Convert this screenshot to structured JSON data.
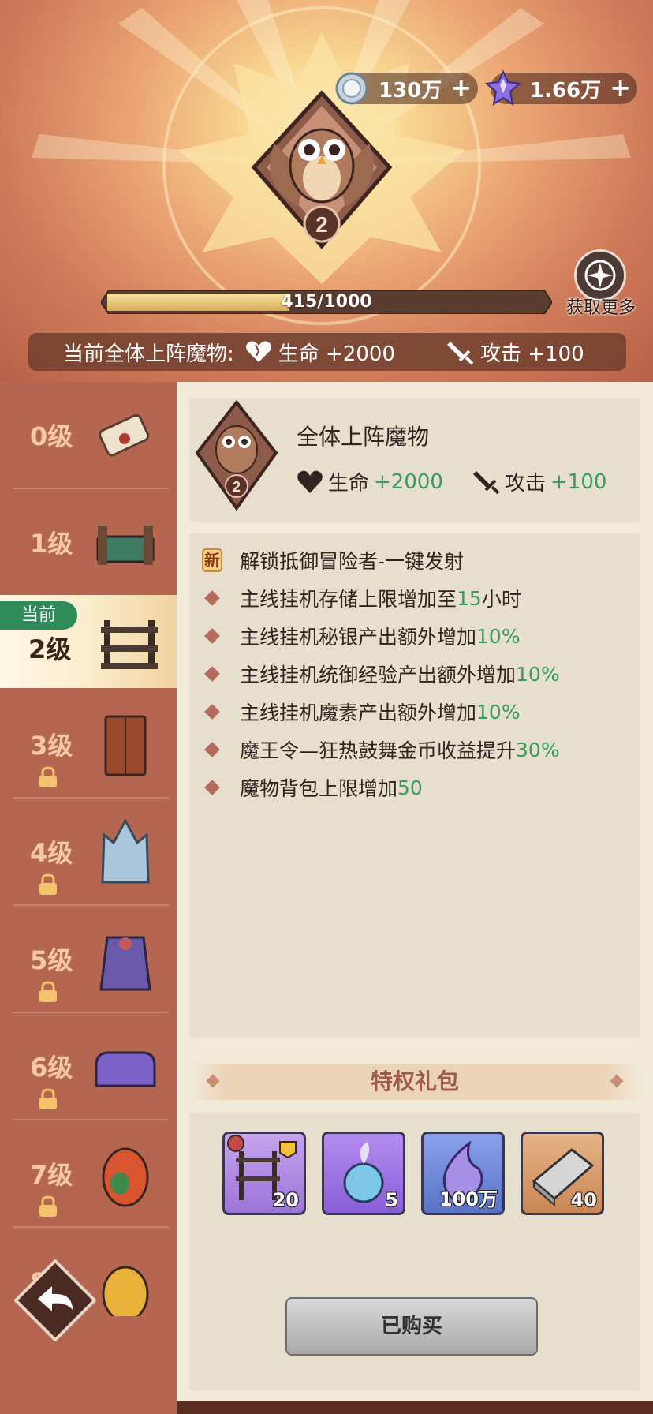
{
  "currencies": [
    {
      "icon": "silver-coin-icon",
      "amount": "130万",
      "plus": "+"
    },
    {
      "icon": "purple-crystal-icon",
      "amount": "1.66万",
      "plus": "+"
    }
  ],
  "header": {
    "badge_level": "2",
    "exp_text": "415/1000",
    "exp_progress": 0.415,
    "get_more_label": "获取更多",
    "bonus_prefix": "当前全体上阵魔物:",
    "bonus_hp": "生命 +2000",
    "bonus_atk": "攻击 +100"
  },
  "levels": [
    {
      "label": "0级",
      "locked": false,
      "current": false,
      "art": "scroll-icon"
    },
    {
      "label": "1级",
      "locked": false,
      "current": false,
      "art": "bed-icon"
    },
    {
      "label": "2级",
      "locked": false,
      "current": true,
      "art": "shelf-icon"
    },
    {
      "label": "3级",
      "locked": true,
      "current": false,
      "art": "wardrobe-icon"
    },
    {
      "label": "4级",
      "locked": true,
      "current": false,
      "art": "crystal-mirror-icon"
    },
    {
      "label": "5级",
      "locked": true,
      "current": false,
      "art": "purple-cabinet-icon"
    },
    {
      "label": "6级",
      "locked": true,
      "current": false,
      "art": "sofa-icon"
    },
    {
      "label": "7级",
      "locked": true,
      "current": false,
      "art": "egg-icon"
    },
    {
      "label": "8级",
      "locked": true,
      "current": false,
      "art": "golden-egg-icon"
    }
  ],
  "current_tag": "当前",
  "summary": {
    "title": "全体上阵魔物",
    "badge_level": "2",
    "hp_label": "生命",
    "hp_value": "+2000",
    "atk_label": "攻击",
    "atk_value": "+100"
  },
  "perks": [
    {
      "tag": "新",
      "text": "解锁抵御冒险者-一键发射",
      "value": ""
    },
    {
      "tag": "",
      "text": "主线挂机存储上限增加至",
      "value": "15",
      "suffix": "小时"
    },
    {
      "tag": "",
      "text": "主线挂机秘银产出额外增加",
      "value": "10%",
      "suffix": ""
    },
    {
      "tag": "",
      "text": "主线挂机统御经验产出额外增加",
      "value": "10%",
      "suffix": ""
    },
    {
      "tag": "",
      "text": "主线挂机魔素产出额外增加",
      "value": "10%",
      "suffix": ""
    },
    {
      "tag": "",
      "text": "魔王令—狂热鼓舞金币收益提升",
      "value": "30%",
      "suffix": ""
    },
    {
      "tag": "",
      "text": "魔物背包上限增加",
      "value": "50",
      "suffix": ""
    }
  ],
  "gift": {
    "title": "特权礼包",
    "items": [
      {
        "icon": "shelf-furniture-icon",
        "qty": "20"
      },
      {
        "icon": "blue-orb-icon",
        "qty": "5"
      },
      {
        "icon": "purple-flame-icon",
        "qty": "100万"
      },
      {
        "icon": "iron-ingot-icon",
        "qty": "40"
      }
    ],
    "button_label": "已购买"
  },
  "colors": {
    "accent_green": "#3b9a5e",
    "panel_bg": "#f2ead9",
    "left_bg": "#b46650",
    "current_tag": "#2f8b5a"
  }
}
